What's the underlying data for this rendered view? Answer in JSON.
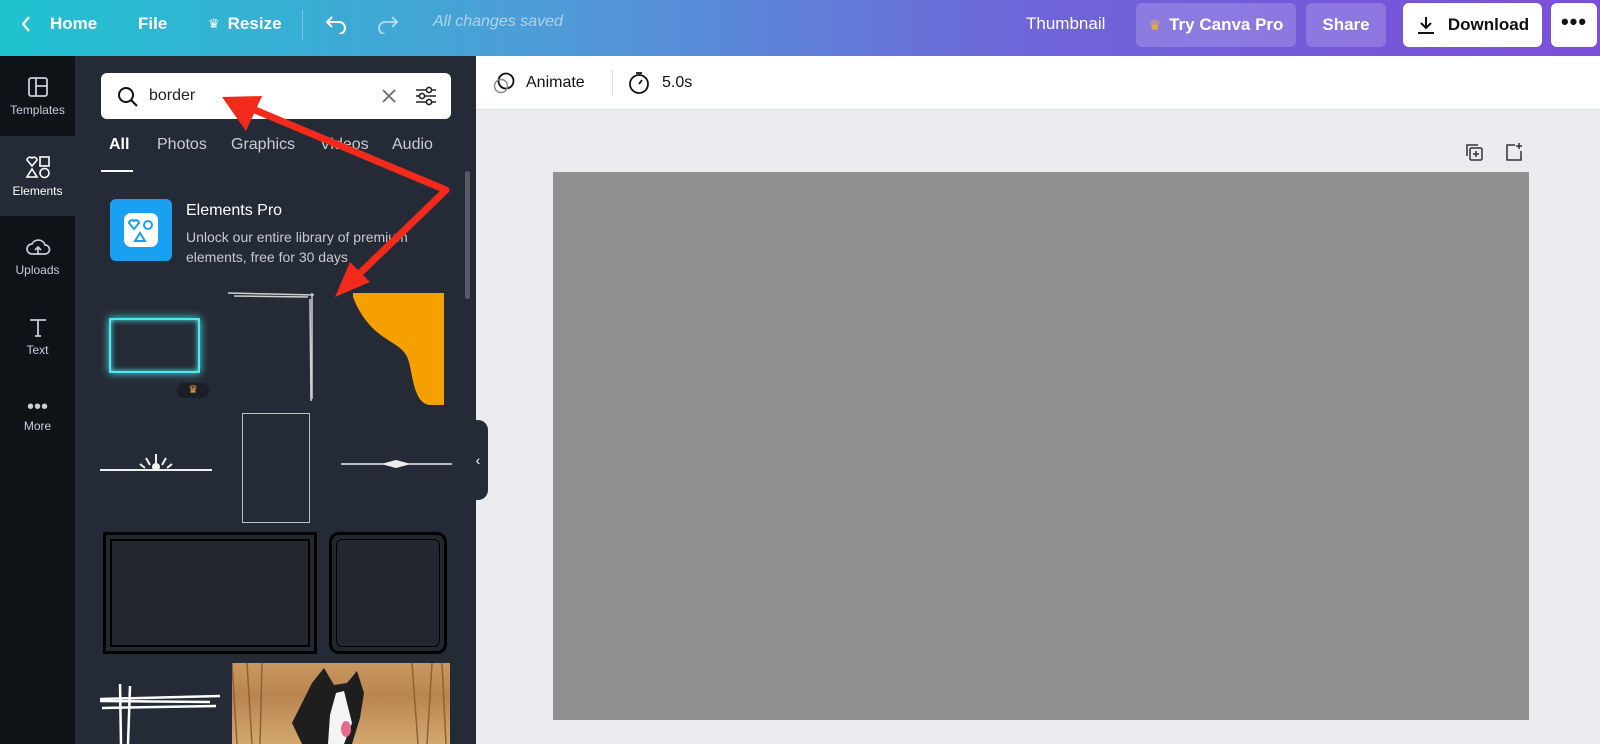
{
  "topbar": {
    "home": "Home",
    "file": "File",
    "resize": "Resize",
    "saved_status": "All changes saved",
    "thumbnail": "Thumbnail",
    "try_pro": "Try Canva Pro",
    "share": "Share",
    "download": "Download"
  },
  "rail": {
    "items": [
      {
        "label": "Templates",
        "icon": "templates-icon"
      },
      {
        "label": "Elements",
        "icon": "shapes-icon"
      },
      {
        "label": "Uploads",
        "icon": "cloud-upload-icon"
      },
      {
        "label": "Text",
        "icon": "text-icon"
      },
      {
        "label": "More",
        "icon": "more-dots-icon"
      }
    ]
  },
  "panel": {
    "search": {
      "value": "border"
    },
    "tabs": [
      "All",
      "Photos",
      "Graphics",
      "Videos",
      "Audio"
    ],
    "promo": {
      "title": "Elements Pro",
      "description": "Unlock our entire library of premium elements, free for 30 days"
    }
  },
  "canvas_toolbar": {
    "animate": "Animate",
    "duration": "5.0s"
  },
  "colors": {
    "accent_orange": "#f6a000",
    "neon_cyan": "#4ee8ee",
    "annotation_red": "#f22a1b",
    "page_gray": "#909090"
  }
}
